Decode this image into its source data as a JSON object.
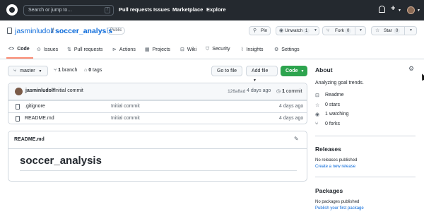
{
  "header": {
    "search_placeholder": "Search or jump to…",
    "search_shortcut": "/",
    "nav": [
      "Pull requests",
      "Issues",
      "Marketplace",
      "Explore"
    ]
  },
  "repo": {
    "owner": "jasminludolf",
    "separator": "/",
    "name": "soccer_analysis",
    "visibility": "Public",
    "pin_label": "Pin",
    "unwatch_label": "Unwatch",
    "unwatch_count": "1",
    "fork_label": "Fork",
    "fork_count": "0",
    "star_label": "Star",
    "star_count": "0"
  },
  "tabs": [
    "Code",
    "Issues",
    "Pull requests",
    "Actions",
    "Projects",
    "Wiki",
    "Security",
    "Insights",
    "Settings"
  ],
  "code": {
    "branch": "master",
    "branch_count": "1",
    "branch_label": "branch",
    "tag_count": "0",
    "tag_label": "tags",
    "goto_file": "Go to file",
    "add_file": "Add file",
    "code_button": "Code"
  },
  "latest_commit": {
    "author": "jasminludolf",
    "message": "Initial commit",
    "sha": "126a8ad",
    "time": "4 days ago",
    "commit_count": "1",
    "commit_label": "commit"
  },
  "files": [
    {
      "name": ".gitignore",
      "message": "Initial commit",
      "time": "4 days ago"
    },
    {
      "name": "README.md",
      "message": "Initial commit",
      "time": "4 days ago"
    }
  ],
  "readme": {
    "filename": "README.md",
    "heading": "soccer_analysis"
  },
  "about": {
    "title": "About",
    "description": "Analyzing goal trends.",
    "items": [
      "Readme",
      "0 stars",
      "1 watching",
      "0 forks"
    ]
  },
  "releases": {
    "title": "Releases",
    "status": "No releases published",
    "link": "Create a new release"
  },
  "packages": {
    "title": "Packages",
    "status": "No packages published",
    "link": "Publish your first package"
  },
  "colors": {
    "accent": "#0969da",
    "primary_button": "#2da44e",
    "header": "#24292f",
    "active_tab": "#fd8c73"
  }
}
